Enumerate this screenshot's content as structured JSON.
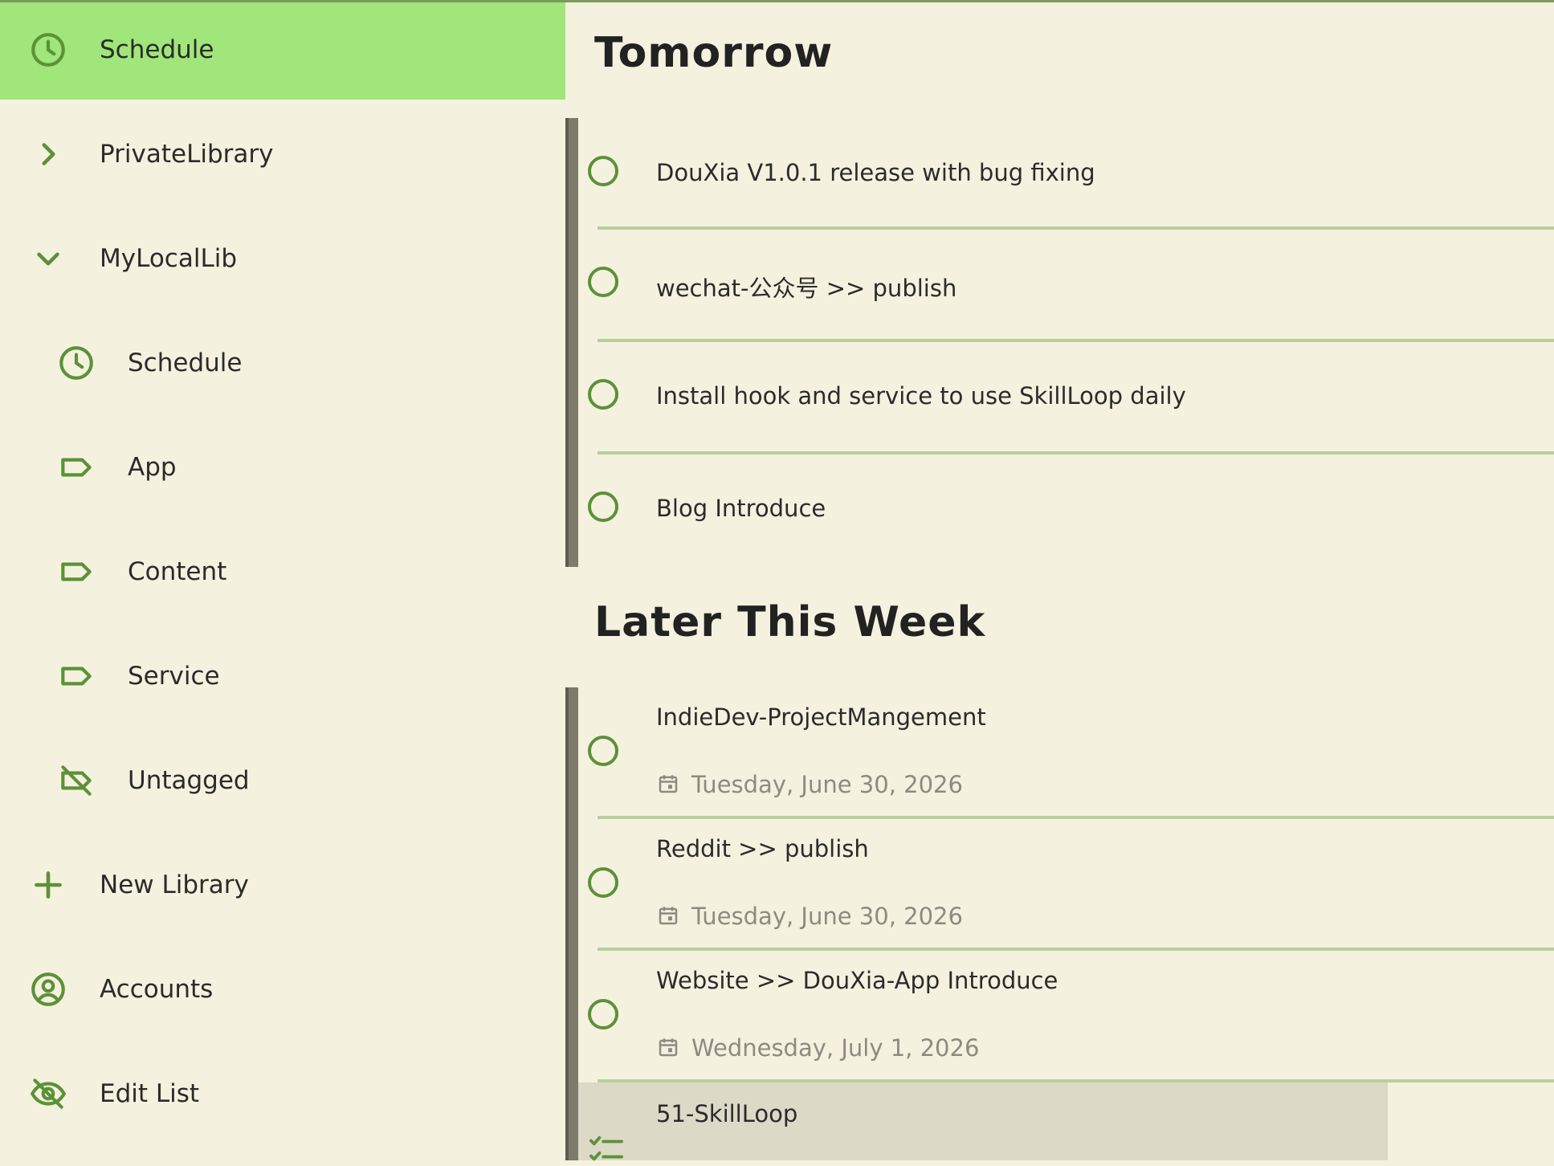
{
  "colors": {
    "background": "#f5f1df",
    "active_item": "#a0e67a",
    "accent_green": "#5c9138",
    "divider": "#b9cf9a",
    "scrollbar": "#7f7b6c",
    "highlight_row": "#dcd9c7",
    "date_text": "#8d8a80"
  },
  "sidebar": {
    "items": [
      {
        "label": "Schedule",
        "icon": "clock-icon",
        "level": 0,
        "active": true
      },
      {
        "label": "PrivateLibrary",
        "icon": "chevron-right-icon",
        "level": 0
      },
      {
        "label": "MyLocalLib",
        "icon": "chevron-down-icon",
        "level": 0
      },
      {
        "label": "Schedule",
        "icon": "clock-icon",
        "level": 1
      },
      {
        "label": "App",
        "icon": "tag-icon",
        "level": 1
      },
      {
        "label": "Content",
        "icon": "tag-icon",
        "level": 1
      },
      {
        "label": "Service",
        "icon": "tag-icon",
        "level": 1
      },
      {
        "label": "Untagged",
        "icon": "tag-off-icon",
        "level": 1
      },
      {
        "label": "New Library",
        "icon": "plus-icon",
        "level": 0
      },
      {
        "label": "Accounts",
        "icon": "account-circle-icon",
        "level": 0
      },
      {
        "label": "Edit List",
        "icon": "eye-off-icon",
        "level": 0
      }
    ]
  },
  "main": {
    "sections": [
      {
        "title": "Tomorrow",
        "tasks": [
          {
            "title": "DouXia V1.0.1 release with bug fixing"
          },
          {
            "title": "wechat-公众号 >> publish"
          },
          {
            "title": "Install hook and service to use SkillLoop daily"
          },
          {
            "title": "Blog Introduce"
          }
        ]
      },
      {
        "title": "Later This Week",
        "tasks": [
          {
            "title": "IndieDev-ProjectMangement",
            "date": "Tuesday, June 30, 2026"
          },
          {
            "title": "Reddit >> publish",
            "date": "Tuesday, June 30, 2026"
          },
          {
            "title": "Website >> DouXia-App Introduce",
            "date": "Wednesday, July 1, 2026"
          },
          {
            "title": "51-SkillLoop",
            "icon": "checklist-icon",
            "highlighted": true
          }
        ]
      }
    ]
  }
}
